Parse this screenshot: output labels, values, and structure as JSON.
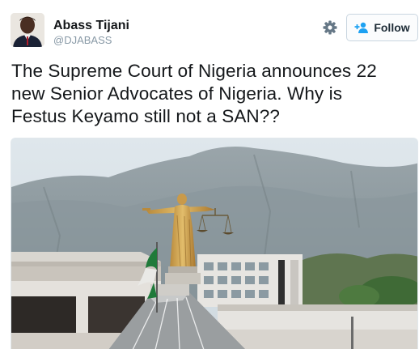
{
  "author": {
    "display_name": "Abass Tijani",
    "handle": "@DJABASS",
    "avatar_icon": "person-avatar"
  },
  "actions": {
    "settings_icon": "gear-icon",
    "follow_icon": "add-user-icon",
    "follow_label": "Follow"
  },
  "tweet": {
    "text_lines": [
      "The Supreme Court of Nigeria announces 22",
      "new Senior Advocates of Nigeria. Why is",
      "Festus Keyamo still not a SAN??"
    ]
  },
  "media": {
    "description_icon": "photo-supreme-court-statue"
  },
  "colors": {
    "accent": "#1da1f2",
    "text": "#14171a",
    "muted": "#8899a6"
  }
}
